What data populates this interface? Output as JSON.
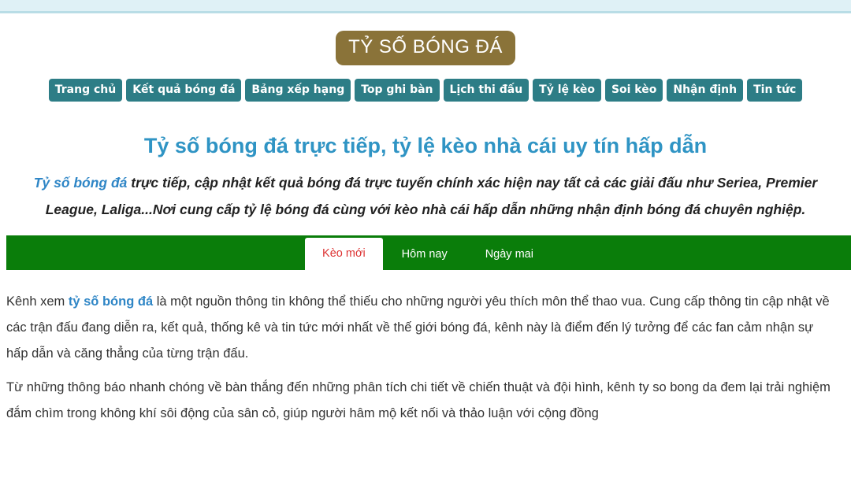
{
  "header": {
    "logo_text": "TỶ SỐ BÓNG ĐÁ"
  },
  "nav": {
    "items": [
      "Trang chủ",
      "Kết quả bóng đá",
      "Bảng xếp hạng",
      "Top ghi bàn",
      "Lịch thi đấu",
      "Tỷ lệ kèo",
      "Soi kèo",
      "Nhận định",
      "Tin tức"
    ]
  },
  "main": {
    "title": "Tỷ số bóng đá trực tiếp, tỷ lệ kèo nhà cái uy tín hấp dẫn",
    "intro_link": "Tỷ số bóng đá",
    "intro_text": " trực tiếp, cập nhật kết quả bóng đá trực tuyến chính xác hiện nay tất cả các giải đấu như Seriea, Premier League, Laliga...Nơi cung cấp tỷ lệ bóng đá cùng với kèo nhà cái hấp dẫn những nhận định bóng đá chuyên nghiệp."
  },
  "tabs": {
    "items": [
      "Kèo mới",
      "Hôm nay",
      "Ngày mai"
    ],
    "active": "Kèo mới"
  },
  "content": {
    "p1_before": "Kênh xem ",
    "p1_link": "tỷ số bóng đá",
    "p1_after": " là một nguồn thông tin không thể thiếu cho những người yêu thích môn thể thao vua. Cung cấp thông tin cập nhật về các trận đấu đang diễn ra, kết quả, thống kê và tin tức mới nhất về thế giới bóng đá, kênh này là điểm đến lý tưởng để các fan cảm nhận sự hấp dẫn và căng thẳng của từng trận đấu.",
    "p2": "Từ những thông báo nhanh chóng về bàn thắng đến những phân tích chi tiết về chiến thuật và đội hình, kênh ty so bong da đem lại trải nghiệm đắm chìm trong không khí sôi động của sân cỏ, giúp người hâm mộ kết nối và thảo luận với cộng đồng"
  },
  "colors": {
    "logo_bg": "#8a7339",
    "nav_bg": "#2d7d86",
    "title": "#2f94c4",
    "tabs_bg": "#0a7d0a",
    "active_tab_text": "#d33333",
    "link": "#2f86c6"
  }
}
